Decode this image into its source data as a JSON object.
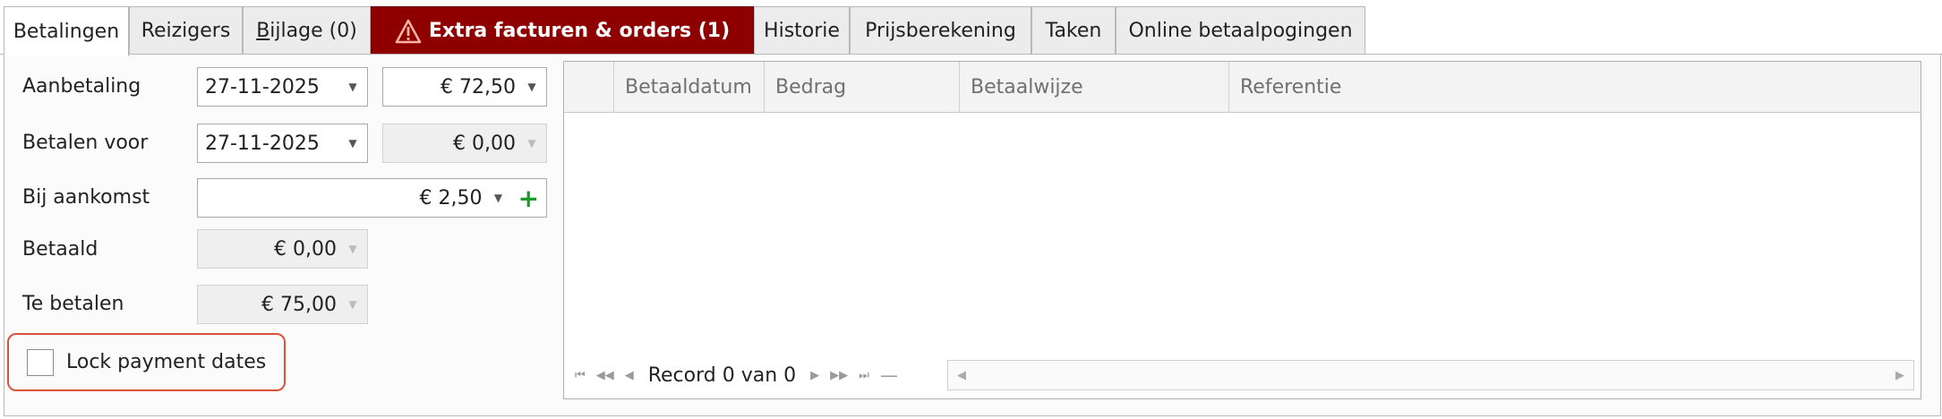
{
  "tabs": [
    {
      "label": "Betalingen",
      "active": true
    },
    {
      "label": "Reizigers"
    },
    {
      "label": "Bijlage (0)",
      "underline_char": "B"
    },
    {
      "label": "Extra facturen & orders (1)",
      "alert": true,
      "icon": "warning-icon"
    },
    {
      "label": "Historie"
    },
    {
      "label": "Prijsberekening"
    },
    {
      "label": "Taken"
    },
    {
      "label": "Online betaalpogingen"
    }
  ],
  "form": {
    "aanbetaling": {
      "label": "Aanbetaling",
      "date": "27-11-2025",
      "amount": "€ 72,50"
    },
    "betalen_voor": {
      "label": "Betalen voor",
      "date": "27-11-2025",
      "amount": "€ 0,00"
    },
    "bij_aankomst": {
      "label": "Bij aankomst",
      "amount": "€ 2,50",
      "add_icon": "plus-icon"
    },
    "betaald": {
      "label": "Betaald",
      "amount": "€ 0,00"
    },
    "te_betalen": {
      "label": "Te betalen",
      "amount": "€ 75,00"
    },
    "lock": {
      "label": "Lock payment dates",
      "checked": false
    }
  },
  "grid": {
    "columns": [
      "Betaaldatum",
      "Bedrag",
      "Betaalwijze",
      "Referentie"
    ],
    "rows": [],
    "navigator": {
      "record_text": "Record 0 van 0"
    }
  },
  "colors": {
    "alert_tab": "#8e0000",
    "plus": "#1e9a2a",
    "highlight_border": "#d9533b"
  }
}
